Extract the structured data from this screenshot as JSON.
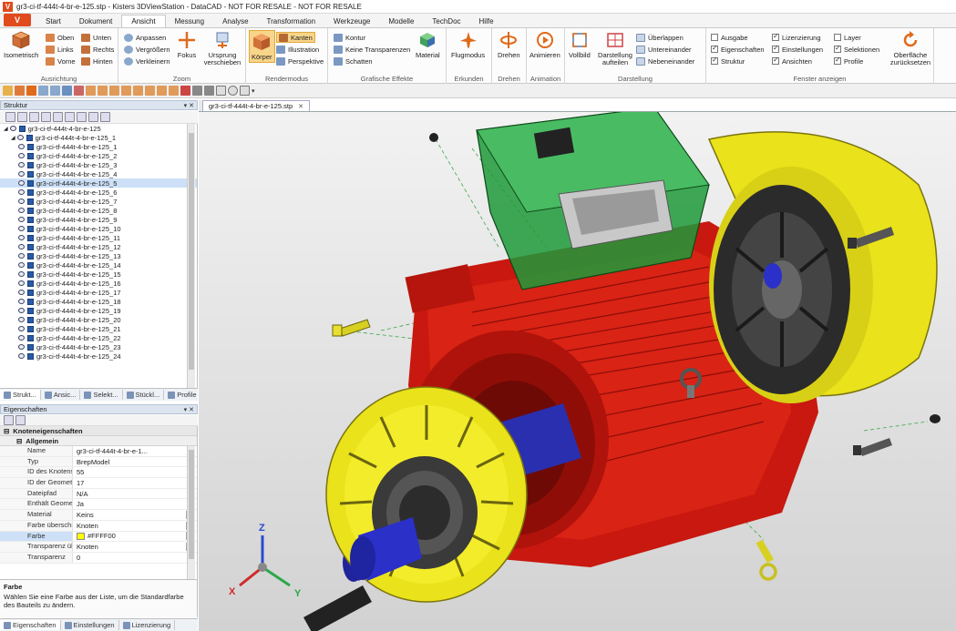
{
  "window": {
    "title": "gr3-ci-tf-444t-4-br-e-125.stp - Kisters 3DViewStation - DataCAD - NOT FOR RESALE - NOT FOR RESALE",
    "app_button": "V"
  },
  "menu": {
    "tabs": [
      "Start",
      "Dokument",
      "Ansicht",
      "Messung",
      "Analyse",
      "Transformation",
      "Werkzeuge",
      "Modelle",
      "TechDoc",
      "Hilfe"
    ],
    "active": "Ansicht"
  },
  "ribbon": {
    "ausrichtung": {
      "label": "Ausrichtung",
      "isometrisch": "Isometrisch",
      "oben": "Oben",
      "unten": "Unten",
      "links": "Links",
      "rechts": "Rechts",
      "vorne": "Vorne",
      "hinten": "Hinten"
    },
    "zoom": {
      "label": "Zoom",
      "anpassen": "Anpassen",
      "vergroessern": "Vergrößern",
      "verkleinern": "Verkleinern",
      "fokus": "Fokus",
      "ursprung": "Ursprung verschieben"
    },
    "rendermodus": {
      "label": "Rendermodus",
      "koerper": "Körper",
      "kanten": "Kanten",
      "illustration": "Illustration",
      "perspektive": "Perspektive"
    },
    "grafische_effekte": {
      "label": "Grafische Effekte",
      "kontur": "Kontur",
      "keine_transparenzen": "Keine Transparenzen",
      "schatten": "Schatten",
      "material": "Material"
    },
    "erkunden": {
      "label": "Erkunden",
      "flugmodus": "Flugmodus"
    },
    "drehen": {
      "label": "Drehen",
      "drehen": "Drehen"
    },
    "animation": {
      "label": "Animation",
      "animieren": "Animieren"
    },
    "darstellung": {
      "label": "Darstellung",
      "vollbild": "Vollbild",
      "aufteilen": "Darstellung aufteilen",
      "ueberlappen": "Überlappen",
      "untereinander": "Untereinander",
      "nebeneinander": "Nebeneinander"
    },
    "fenster": {
      "label": "Fenster anzeigen",
      "items": [
        {
          "label": "Ausgabe",
          "checked": false
        },
        {
          "label": "Eigenschaften",
          "checked": true
        },
        {
          "label": "Struktur",
          "checked": true
        },
        {
          "label": "Lizenzierung",
          "checked": true
        },
        {
          "label": "Einstellungen",
          "checked": true
        },
        {
          "label": "Ansichten",
          "checked": true
        },
        {
          "label": "Layer",
          "checked": false
        },
        {
          "label": "Selektionen",
          "checked": true
        },
        {
          "label": "Profile",
          "checked": true
        }
      ],
      "oberflaeche": "Oberfläche zurücksetzen"
    }
  },
  "structure": {
    "title": "Struktur",
    "root": "gr3-ci-tf-444t-4-br-e-125",
    "child": "gr3-ci-tf-444t-4-br-e-125_1",
    "items": [
      "gr3-ci-tf-444t-4-br-e-125_1",
      "gr3-ci-tf-444t-4-br-e-125_2",
      "gr3-ci-tf-444t-4-br-e-125_3",
      "gr3-ci-tf-444t-4-br-e-125_4",
      "gr3-ci-tf-444t-4-br-e-125_5",
      "gr3-ci-tf-444t-4-br-e-125_6",
      "gr3-ci-tf-444t-4-br-e-125_7",
      "gr3-ci-tf-444t-4-br-e-125_8",
      "gr3-ci-tf-444t-4-br-e-125_9",
      "gr3-ci-tf-444t-4-br-e-125_10",
      "gr3-ci-tf-444t-4-br-e-125_11",
      "gr3-ci-tf-444t-4-br-e-125_12",
      "gr3-ci-tf-444t-4-br-e-125_13",
      "gr3-ci-tf-444t-4-br-e-125_14",
      "gr3-ci-tf-444t-4-br-e-125_15",
      "gr3-ci-tf-444t-4-br-e-125_16",
      "gr3-ci-tf-444t-4-br-e-125_17",
      "gr3-ci-tf-444t-4-br-e-125_18",
      "gr3-ci-tf-444t-4-br-e-125_19",
      "gr3-ci-tf-444t-4-br-e-125_20",
      "gr3-ci-tf-444t-4-br-e-125_21",
      "gr3-ci-tf-444t-4-br-e-125_22",
      "gr3-ci-tf-444t-4-br-e-125_23",
      "gr3-ci-tf-444t-4-br-e-125_24"
    ],
    "selected_index": 4,
    "tabs": [
      "Strukt...",
      "Ansic...",
      "Selekt...",
      "Stückl...",
      "Profile"
    ]
  },
  "properties": {
    "title": "Eigenschaften",
    "section": "Knoteneigenschaften",
    "subsection": "Allgemein",
    "rows": [
      {
        "k": "Name",
        "v": "gr3-ci-tf-444t-4-br-e-1..."
      },
      {
        "k": "Typ",
        "v": "BrepModel"
      },
      {
        "k": "ID des Knotens",
        "v": "55"
      },
      {
        "k": "ID der Geometrie",
        "v": "17"
      },
      {
        "k": "Dateipfad",
        "v": "N/A"
      },
      {
        "k": "Enthält Geometrie (...",
        "v": "Ja"
      },
      {
        "k": "Material",
        "v": "Keins"
      },
      {
        "k": "Farbe überschreiben",
        "v": "Knoten"
      },
      {
        "k": "Farbe",
        "v": "#FFFF00"
      },
      {
        "k": "Transparenz überschc...",
        "v": "Knoten"
      },
      {
        "k": "Transparenz",
        "v": "0"
      }
    ],
    "help_title": "Farbe",
    "help_text": "Wählen Sie eine Farbe aus der Liste, um die Standardfarbe des Bauteils zu ändern.",
    "tabs": [
      "Eigenschaften",
      "Einstellungen",
      "Lizenzierung"
    ]
  },
  "document_tab": "gr3-ci-tf-444t-4-br-e-125.stp",
  "axes": {
    "x": "X",
    "y": "Y",
    "z": "Z"
  },
  "colors": {
    "accent": "#e04a1c",
    "housing": "#d41a10",
    "flange": "#f2ea1a",
    "box": "#1f9a3a",
    "shaft": "#2a2fb0"
  }
}
